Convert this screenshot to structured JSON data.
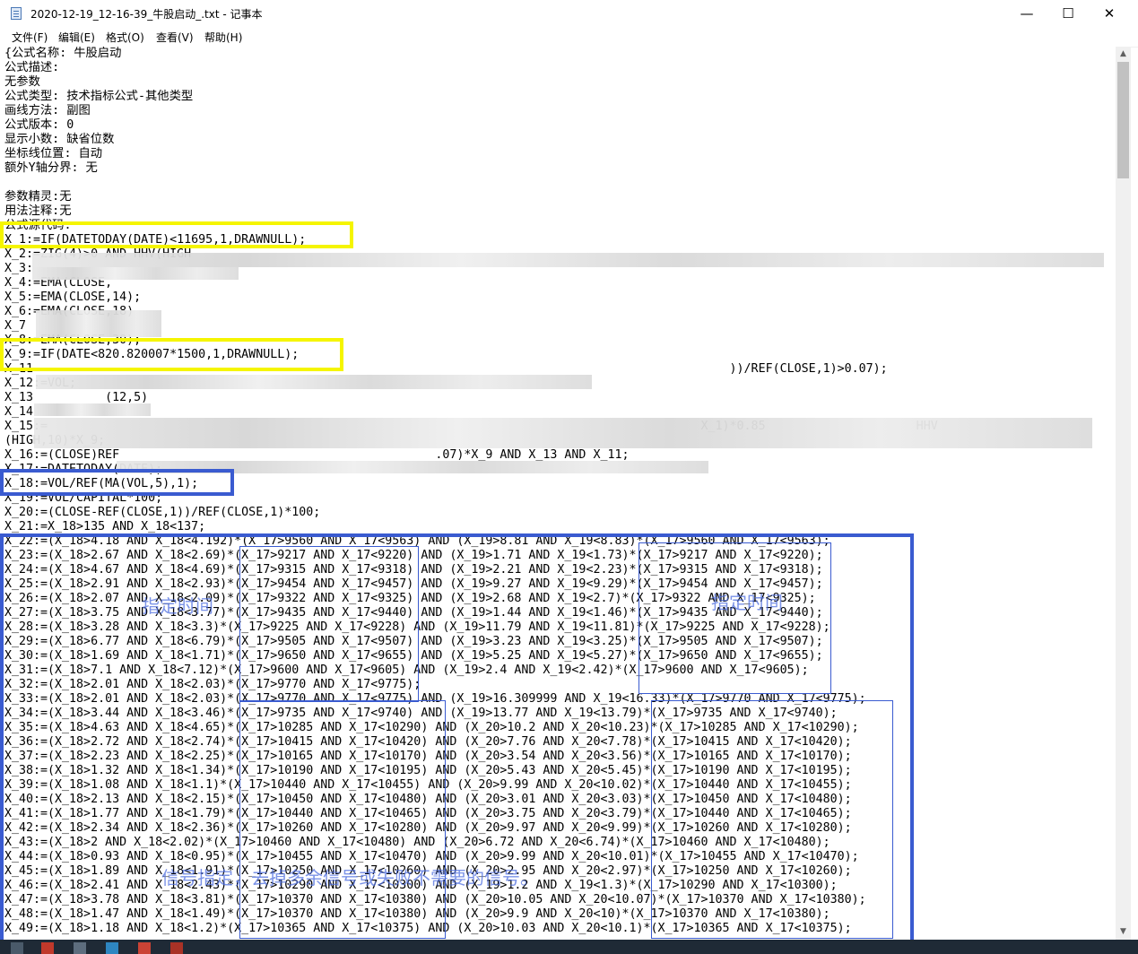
{
  "window": {
    "title": "2020-12-19_12-16-39_牛股启动_.txt - 记事本",
    "minimize": "—",
    "maximize": "☐",
    "close": "✕"
  },
  "menu": [
    "文件(F)",
    "编辑(E)",
    "格式(O)",
    "查看(V)",
    "帮助(H)"
  ],
  "document": {
    "text": "{公式名称: 牛股启动\n公式描述:\n无参数\n公式类型: 技术指标公式-其他类型\n画线方法: 副图\n公式版本: 0\n显示小数: 缺省位数\n坐标线位置: 自动\n额外Y轴分界: 无\n\n参数精灵:无\n用法注释:无\n公式源代码:\nX_1:=IF(DATETODAY(DATE)<11695,1,DRAWNULL);\nX_2:=ZIG(4)>0 AND HHV(HIGH\nX_3:\nX_4:=EMA(CLOSE,\nX_5:=EMA(CLOSE,14);\nX_6:=EMA(CLOSE,18)\nX_7\nX_8:=EMA(CLOSE,30);\nX_9:=IF(DATE<820.820007*1500,1,DRAWNULL);\nX_11                                                                                                 ))/REF(CLOSE,1)>0.07);\nX_12:=VOL;\nX_13          (12,5)\nX_14\nX_15:=                                                                                           X_1)*0.85                     HHV\n(HIGH,10)*X_9;\nX_16:=(CLOSE)REF                                            .07)*X_9 AND X_13 AND X_11;\nX_17:=DATETODAY(DATE);\nX_18:=VOL/REF(MA(VOL,5),1);\nX_19:=VOL/CAPITAL*100;\nX_20:=(CLOSE-REF(CLOSE,1))/REF(CLOSE,1)*100;\nX_21:=X_18>135 AND X_18<137;\nX_22:=(X_18>4.18 AND X_18<4.192)*(X_17>9560 AND X_17<9563) AND (X_19>8.81 AND X_19<8.83)*(X_17>9560 AND X_17<9563);\nX_23:=(X_18>2.67 AND X_18<2.69)*(X_17>9217 AND X_17<9220) AND (X_19>1.71 AND X_19<1.73)*(X_17>9217 AND X_17<9220);\nX_24:=(X_18>4.67 AND X_18<4.69)*(X_17>9315 AND X_17<9318) AND (X_19>2.21 AND X_19<2.23)*(X_17>9315 AND X_17<9318);\nX_25:=(X_18>2.91 AND X_18<2.93)*(X_17>9454 AND X_17<9457) AND (X_19>9.27 AND X_19<9.29)*(X_17>9454 AND X_17<9457);\nX_26:=(X_18>2.07 AND X_18<2.09)*(X_17>9322 AND X_17<9325) AND (X_19>2.68 AND X_19<2.7)*(X_17>9322 AND X_17<9325);\nX_27:=(X_18>3.75 AND X_18<3.77)*(X_17>9435 AND X_17<9440) AND (X_19>1.44 AND X_19<1.46)*(X_17>9435 AND X_17<9440);\nX_28:=(X_18>3.28 AND X_18<3.3)*(X_17>9225 AND X_17<9228) AND (X_19>11.79 AND X_19<11.81)*(X_17>9225 AND X_17<9228);\nX_29:=(X_18>6.77 AND X_18<6.79)*(X_17>9505 AND X_17<9507) AND (X_19>3.23 AND X_19<3.25)*(X_17>9505 AND X_17<9507);\nX_30:=(X_18>1.69 AND X_18<1.71)*(X_17>9650 AND X_17<9655) AND (X_19>5.25 AND X_19<5.27)*(X_17>9650 AND X_17<9655);\nX_31:=(X_18>7.1 AND X_18<7.12)*(X_17>9600 AND X_17<9605) AND (X_19>2.4 AND X_19<2.42)*(X_17>9600 AND X_17<9605);\nX_32:=(X_18>2.01 AND X_18<2.03)*(X_17>9770 AND X_17<9775);\nX_33:=(X_18>2.01 AND X_18<2.03)*(X_17>9770 AND X_17<9775) AND (X_19>16.309999 AND X_19<16.33)*(X_17>9770 AND X_17<9775);\nX_34:=(X_18>3.44 AND X_18<3.46)*(X_17>9735 AND X_17<9740) AND (X_19>13.77 AND X_19<13.79)*(X_17>9735 AND X_17<9740);\nX_35:=(X_18>4.63 AND X_18<4.65)*(X_17>10285 AND X_17<10290) AND (X_20>10.2 AND X_20<10.23)*(X_17>10285 AND X_17<10290);\nX_36:=(X_18>2.72 AND X_18<2.74)*(X_17>10415 AND X_17<10420) AND (X_20>7.76 AND X_20<7.78)*(X_17>10415 AND X_17<10420);\nX_37:=(X_18>2.23 AND X_18<2.25)*(X_17>10165 AND X_17<10170) AND (X_20>3.54 AND X_20<3.56)*(X_17>10165 AND X_17<10170);\nX_38:=(X_18>1.32 AND X_18<1.34)*(X_17>10190 AND X_17<10195) AND (X_20>5.43 AND X_20<5.45)*(X_17>10190 AND X_17<10195);\nX_39:=(X_18>1.08 AND X_18<1.1)*(X_17>10440 AND X_17<10455) AND (X_20>9.99 AND X_20<10.02)*(X_17>10440 AND X_17<10455);\nX_40:=(X_18>2.13 AND X_18<2.15)*(X_17>10450 AND X_17<10480) AND (X_20>3.01 AND X_20<3.03)*(X_17>10450 AND X_17<10480);\nX_41:=(X_18>1.77 AND X_18<1.79)*(X_17>10440 AND X_17<10465) AND (X_20>3.75 AND X_20<3.79)*(X_17>10440 AND X_17<10465);\nX_42:=(X_18>2.34 AND X_18<2.36)*(X_17>10260 AND X_17<10280) AND (X_20>9.97 AND X_20<9.99)*(X_17>10260 AND X_17<10280);\nX_43:=(X_18>2 AND X_18<2.02)*(X_17>10460 AND X_17<10480) AND (X_20>6.72 AND X_20<6.74)*(X_17>10460 AND X_17<10480);\nX_44:=(X_18>0.93 AND X_18<0.95)*(X_17>10455 AND X_17<10470) AND (X_20>9.99 AND X_20<10.01)*(X_17>10455 AND X_17<10470);\nX_45:=(X_18>1.89 AND X_18<1.91)*(X_17>10250 AND X_17<10260) AND (X_20>2.95 AND X_20<2.97)*(X_17>10250 AND X_17<10260);\nX_46:=(X_18>2.41 AND X_18<2.43)*(X_17>10290 AND X_17<10300) AND (X_19>1.2 AND X_19<1.3)*(X_17>10290 AND X_17<10300);\nX_47:=(X_18>3.78 AND X_18<3.81)*(X_17>10370 AND X_17<10380) AND (X_20>10.05 AND X_20<10.07)*(X_17>10370 AND X_17<10380);\nX_48:=(X_18>1.47 AND X_18<1.49)*(X_17>10370 AND X_17<10380) AND (X_20>9.9 AND X_20<10)*(X_17>10370 AND X_17<10380);\nX_49:=(X_18>1.18 AND X_18<1.2)*(X_17>10365 AND X_17<10375) AND (X_20>10.03 AND X_20<10.1)*(X_17>10365 AND X_17<10375);"
  },
  "annotations": {
    "specified_time_1": "指定时间",
    "specified_time_2": "指定时间",
    "signal_note": "信号指定，去掉多余信号或失败不需要的信号。"
  },
  "scrollbar": {
    "up": "▲",
    "down": "▼"
  }
}
